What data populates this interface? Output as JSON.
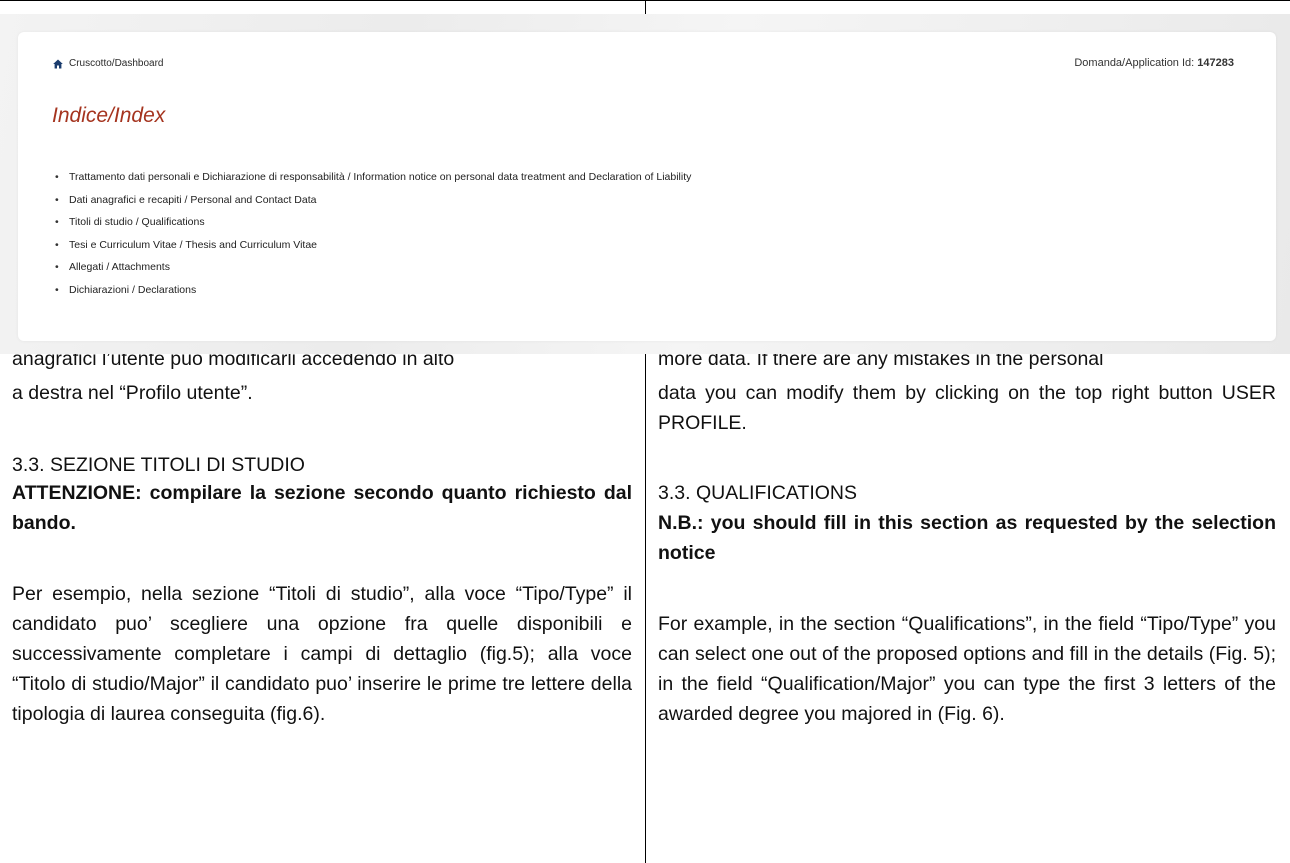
{
  "screenshot": {
    "breadcrumb": "Cruscotto/Dashboard",
    "app_id_label": "Domanda/Application Id:",
    "app_id_value": "147283",
    "title": "Indice/Index",
    "index_items": [
      "Trattamento dati personali e Dichiarazione di responsabilità / Information notice on personal data treatment and Declaration of Liability",
      "Dati anagrafici e recapiti / Personal and Contact Data",
      "Titoli di studio / Qualifications",
      "Tesi e Curriculum Vitae / Thesis and Curriculum Vitae",
      "Allegati / Attachments",
      "Dichiarazioni / Declarations"
    ],
    "accent_color": "#a5341f"
  },
  "left": {
    "line1": "anagrafici l’utente può modificarli accedendo in alto",
    "line2": "a destra nel “Profilo utente”.",
    "section_heading": "3.3. SEZIONE TITOLI DI STUDIO",
    "warning": "ATTENZIONE: compilare la sezione secondo quanto richiesto dal bando.",
    "para": "Per esempio, nella sezione “Titoli di studio”, alla voce “Tipo/Type” il candidato puo’ scegliere una opzione fra quelle disponibili e successivamente completare i campi di dettaglio (fig.5); alla voce “Titolo di studio/Major” il candidato puo’ inserire le prime tre lettere della tipologia di laurea conseguita (fig.6)."
  },
  "right": {
    "line1": "more data. If there are any mistakes in the personal",
    "line2": "data you can modify them by clicking on the top right button USER PROFILE.",
    "section_heading": "3.3. QUALIFICATIONS",
    "warning": "N.B.: you should fill in this section as requested by the selection notice",
    "para": "For example, in the section “Qualifications”, in the field “Tipo/Type” you can select one out of the proposed options and fill in the details (Fig. 5); in the field “Qualification/Major” you can type the first 3 letters of the awarded degree you majored in (Fig. 6)."
  }
}
